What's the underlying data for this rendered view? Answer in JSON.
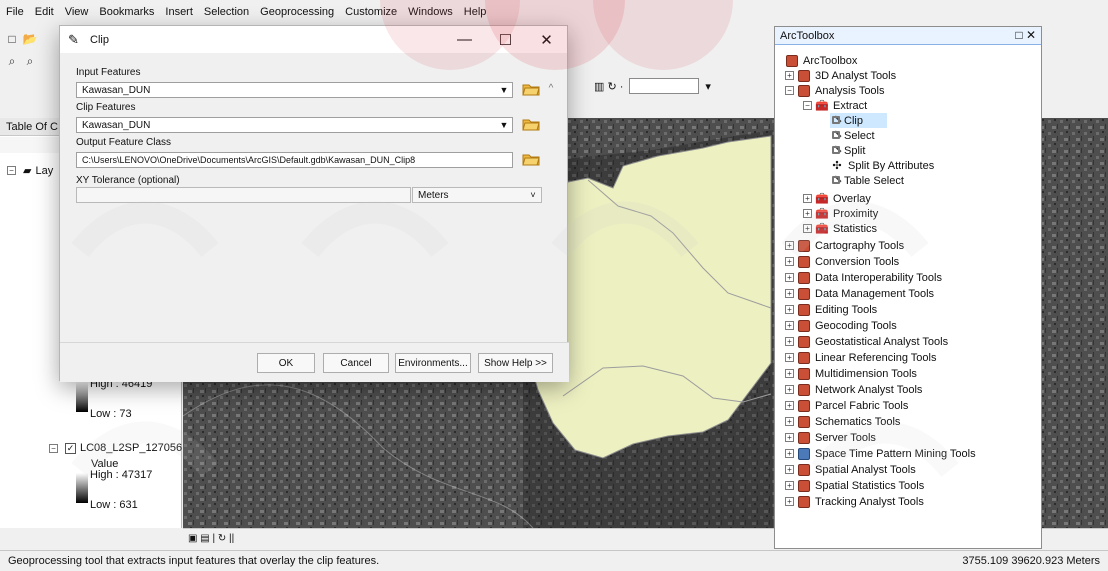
{
  "menubar": {
    "items": [
      "File",
      "Edit",
      "View",
      "Bookmarks",
      "Insert",
      "Selection",
      "Geoprocessing",
      "Customize",
      "Windows",
      "Help"
    ]
  },
  "toc": {
    "title": "Table Of C",
    "layers_label": "Lay",
    "legend1_high": "High : 46419",
    "legend1_low": "Low : 73",
    "raster_name": "LC08_L2SP_127056",
    "value_label": "Value",
    "legend2_high": "High : 47317",
    "legend2_low": "Low : 631"
  },
  "dialog": {
    "title": "Clip",
    "input_label": "Input Features",
    "input_value": "Kawasan_DUN",
    "clip_label": "Clip Features",
    "clip_value": "Kawasan_DUN",
    "output_label": "Output Feature Class",
    "output_value": "C:\\Users\\LENOVO\\OneDrive\\Documents\\ArcGIS\\Default.gdb\\Kawasan_DUN_Clip8",
    "tolerance_label": "XY Tolerance (optional)",
    "tolerance_unit": "Meters",
    "buttons": {
      "ok": "OK",
      "cancel": "Cancel",
      "environments": "Environments...",
      "show_help": "Show Help >>"
    }
  },
  "toolbox": {
    "title": "ArcToolbox",
    "items": [
      "ArcToolbox",
      "3D Analyst Tools",
      "Analysis Tools",
      "Extract",
      "Clip",
      "Select",
      "Split",
      "Split By Attributes",
      "Table Select",
      "Overlay",
      "Proximity",
      "Statistics",
      "Cartography Tools",
      "Conversion Tools",
      "Data Interoperability Tools",
      "Data Management Tools",
      "Editing Tools",
      "Geocoding Tools",
      "Geostatistical Analyst Tools",
      "Linear Referencing Tools",
      "Multidimension Tools",
      "Network Analyst Tools",
      "Parcel Fabric Tools",
      "Schematics Tools",
      "Server Tools",
      "Space Time Pattern Mining Tools",
      "Spatial Analyst Tools",
      "Spatial Statistics Tools",
      "Tracking Analyst Tools"
    ]
  },
  "status": {
    "message": "Geoprocessing tool that extracts input features that overlay the clip features.",
    "coords": "3755.109  39620.923 Meters"
  },
  "colors": {
    "map_polygon": "#edf0c1",
    "accent": "#1f5fbf",
    "toolbox_red": "#c94f36"
  },
  "icons": {
    "folder": "folder-open-icon",
    "clip": "clip-tool-icon"
  }
}
